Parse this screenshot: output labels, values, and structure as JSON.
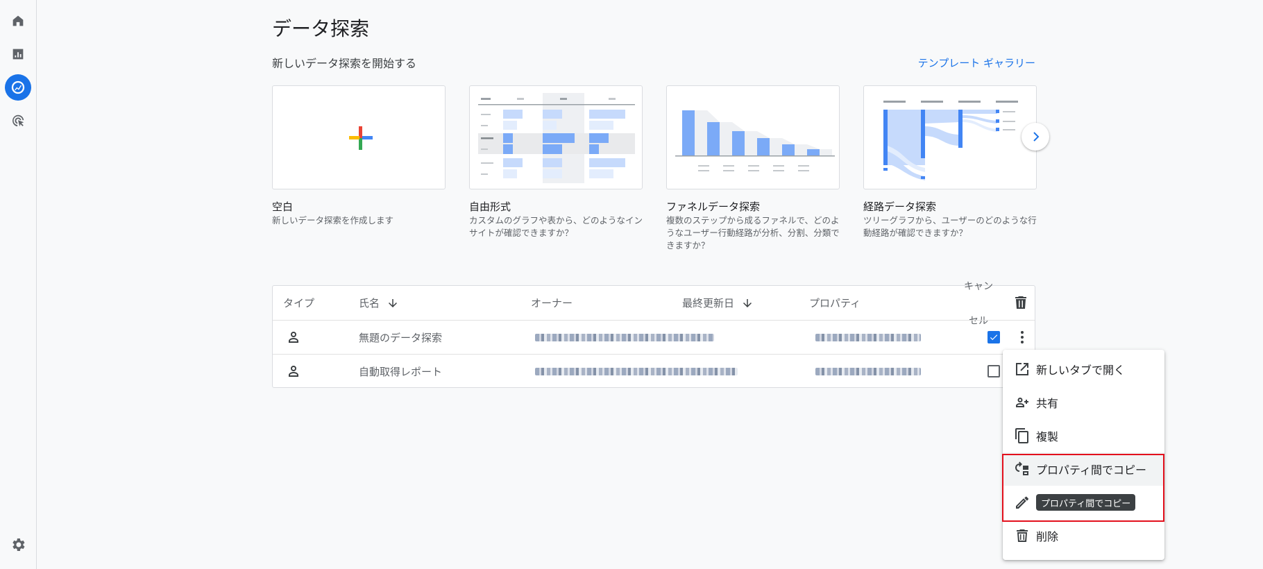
{
  "page": {
    "title": "データ探索",
    "section_label": "新しいデータ探索を開始する",
    "gallery_link": "テンプレート ギャラリー"
  },
  "rail": {
    "items": [
      "home-icon",
      "reports-icon",
      "explore-icon",
      "advertising-icon"
    ],
    "settings_icon": "gear-icon"
  },
  "templates": [
    {
      "title": "空白",
      "desc": "新しいデータ探索を作成します"
    },
    {
      "title": "自由形式",
      "desc": "カスタムのグラフや表から、どのようなインサイトが確認できますか？"
    },
    {
      "title": "ファネルデータ探索",
      "desc": "複数のステップから成るファネルで、どのようなユーザー行動経路が分析、分割、分類できますか？"
    },
    {
      "title": "経路データ探索",
      "desc": "ツリーグラフから、ユーザーのどのような行動経路が確認できますか？"
    }
  ],
  "table": {
    "headers": {
      "type": "タイプ",
      "name": "氏名",
      "owner": "オーナー",
      "updated": "最終更新日",
      "property": "プロパティ",
      "cancel_1": "キャン",
      "cancel_2": "セル"
    },
    "rows": [
      {
        "name": "無題のデータ探索",
        "checked": true
      },
      {
        "name": "自動取得レポート",
        "checked": false
      }
    ]
  },
  "menu": {
    "items": [
      {
        "label": "新しいタブで開く",
        "icon": "open-in-new-icon"
      },
      {
        "label": "共有",
        "icon": "share-person-icon"
      },
      {
        "label": "複製",
        "icon": "duplicate-icon"
      },
      {
        "label": "プロパティ間でコピー",
        "icon": "copy-property-icon"
      },
      {
        "label": "",
        "icon": "pencil-icon"
      },
      {
        "label": "削除",
        "icon": "trash-icon"
      }
    ],
    "tooltip": "プロパティ間でコピー"
  },
  "colors": {
    "accent": "#1a73e8",
    "highlight": "#e3101c"
  }
}
